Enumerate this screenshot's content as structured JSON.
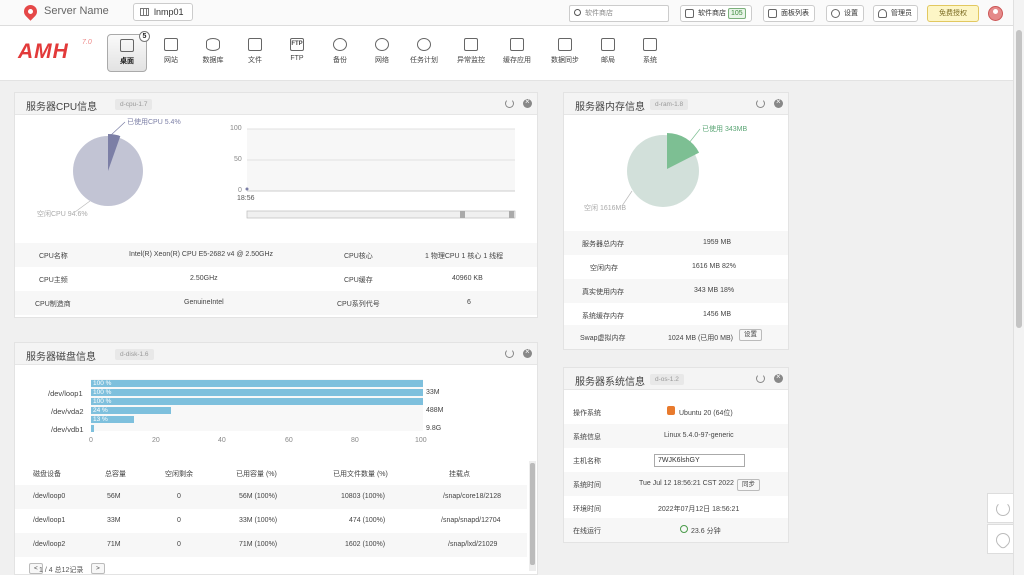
{
  "topbar": {
    "server_name": "Server Name",
    "host_tab": "lnmp01",
    "search_placeholder": "软件商店",
    "store_label": "软件商店",
    "store_count": "105",
    "panel_list": "面板列表",
    "settings": "设置",
    "admin": "管理员",
    "free": "免费授权"
  },
  "nav": {
    "brand": "AMH",
    "brand_ver": "7.0",
    "items": [
      {
        "label": "桌面",
        "badge": "5"
      },
      {
        "label": "网站"
      },
      {
        "label": "数据库"
      },
      {
        "label": "文件"
      },
      {
        "label": "FTP"
      },
      {
        "label": "备份"
      },
      {
        "label": "网络"
      },
      {
        "label": "任务计划"
      },
      {
        "label": "异常监控"
      },
      {
        "label": "缓存应用"
      },
      {
        "label": "数据同步"
      },
      {
        "label": "邮局"
      },
      {
        "label": "系统"
      }
    ]
  },
  "cpu": {
    "title": "服务器CPU信息",
    "id": "d-cpu-1.7",
    "used_label": "已使用CPU 5.4%",
    "free_label": "空闲CPU 94.6%",
    "used_pct": 5.4,
    "ticks": [
      "100",
      "50",
      "0"
    ],
    "time": "18:56",
    "rows": [
      {
        "k1": "CPU名称",
        "v1": "Intel(R) Xeon(R) CPU E5-2682 v4 @ 2.50GHz",
        "k2": "CPU核心",
        "v2": "1 物理CPU  1 核心  1 线程"
      },
      {
        "k1": "CPU主频",
        "v1": "2.50GHz",
        "k2": "CPU缓存",
        "v2": "40960 KB"
      },
      {
        "k1": "CPU制造商",
        "v1": "GenuineIntel",
        "k2": "CPU系列代号",
        "v2": "6"
      }
    ]
  },
  "ram": {
    "title": "服务器内存信息",
    "id": "d-ram-1.8",
    "used_label": "已使用 343MB",
    "free_label": "空闲 1616MB",
    "used_pct": 17.5,
    "rows": [
      {
        "k": "服务器总内存",
        "v": "1959 MB"
      },
      {
        "k": "空闲内存",
        "v": "1616 MB   82%"
      },
      {
        "k": "真实使用内存",
        "v": "343 MB   18%"
      },
      {
        "k": "系统缓存内存",
        "v": "1456 MB"
      },
      {
        "k": "Swap虚拟内存",
        "v": "1024 MB (已用0 MB)",
        "btn": "设置"
      }
    ]
  },
  "disk": {
    "title": "服务器磁盘信息",
    "id": "d-disk-1.6",
    "chart_data": {
      "type": "bar",
      "categories": [
        "/dev/loop1",
        "/dev/vda2",
        "/dev/vdb1"
      ],
      "bars": [
        {
          "pct": 100,
          "label": "100 %"
        },
        {
          "pct": 100,
          "label": "100 %"
        },
        {
          "pct": 100,
          "label": "100 %"
        },
        {
          "pct": 24,
          "label": "24 %"
        },
        {
          "pct": 13,
          "label": "13 %"
        },
        {
          "pct": 1,
          "label": ""
        }
      ],
      "right_labels": [
        "33M",
        "488M",
        "9.8G"
      ],
      "xticks": [
        "0",
        "20",
        "40",
        "60",
        "80",
        "100"
      ]
    },
    "headers": [
      "磁盘设备",
      "总容量",
      "空闲剩余",
      "已用容量 (%)",
      "已用文件数量 (%)",
      "挂载点"
    ],
    "rows": [
      [
        "/dev/loop0",
        "56M",
        "0",
        "56M (100%)",
        "10803 (100%)",
        "/snap/core18/2128"
      ],
      [
        "/dev/loop1",
        "33M",
        "0",
        "33M (100%)",
        "474 (100%)",
        "/snap/snapd/12704"
      ],
      [
        "/dev/loop2",
        "71M",
        "0",
        "71M (100%)",
        "1602 (100%)",
        "/snap/lxd/21029"
      ]
    ],
    "pager": "1 / 4 总12记录",
    "prev": "<",
    "next": ">"
  },
  "os": {
    "title": "服务器系统信息",
    "id": "d-os-1.2",
    "rows": [
      {
        "k": "操作系统",
        "v": "Ubuntu 20 (64位)"
      },
      {
        "k": "系统信息",
        "v": "Linux 5.4.0-97-generic"
      },
      {
        "k": "主机名称",
        "v": "7WJK6lshGY"
      },
      {
        "k": "系统时间",
        "v": "Tue Jul 12 18:56:21 CST 2022",
        "btn": "同步"
      },
      {
        "k": "环境时间",
        "v": "2022年07月12日 18:56:21"
      },
      {
        "k": "在线运行",
        "v": "23.6 分钟"
      }
    ]
  },
  "colors": {
    "cpu_pie": "#c2c4d4",
    "cpu_used": "#7c7fa6",
    "ram_pie": "#d2e0da",
    "ram_used": "#7dbf93",
    "bar": "#7ec0dd"
  }
}
